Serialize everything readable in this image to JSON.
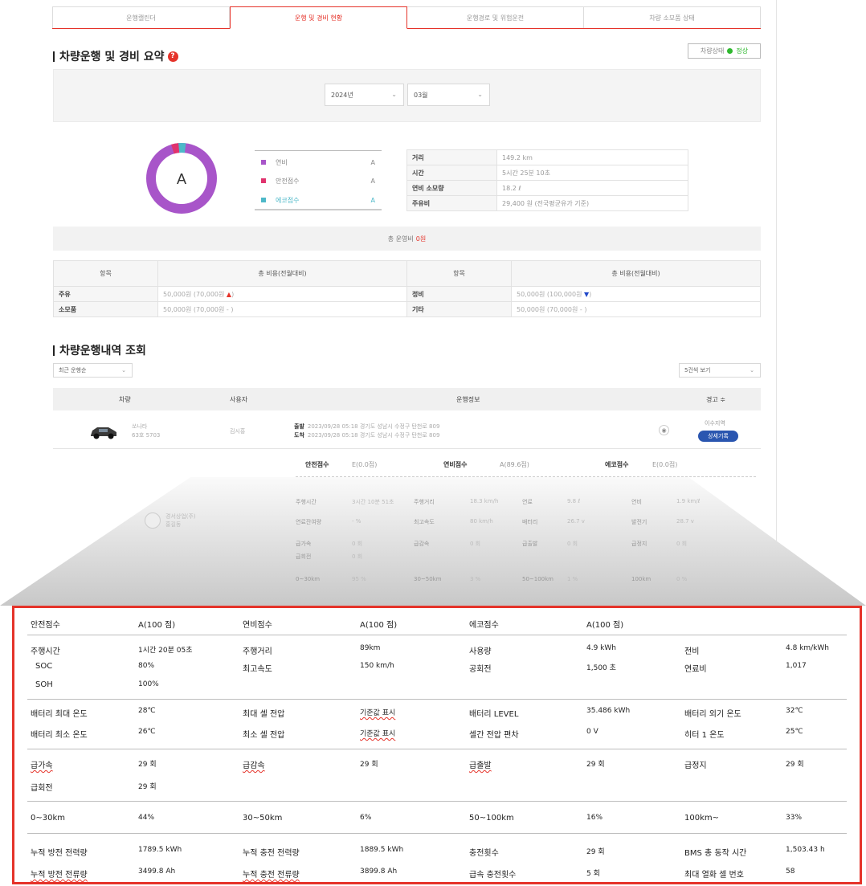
{
  "tabs": [
    "운행캘린더",
    "운행 및 경비 현황",
    "운행경로 및 위험운전",
    "차량 소모품 상태"
  ],
  "summary": {
    "title": "차량운행 및 경비 요약",
    "help": "?",
    "status_label": "차량상태",
    "status_value": "정상",
    "year": "2024년",
    "month": "03월",
    "grade": "A",
    "legend": [
      {
        "label": "연비",
        "grade": "A",
        "color": "#a855c9"
      },
      {
        "label": "안전점수",
        "grade": "A",
        "color": "#e0336e"
      },
      {
        "label": "에코점수",
        "grade": "A",
        "color": "#4db8c8"
      }
    ],
    "info": [
      {
        "key": "거리",
        "value": "149.2 km"
      },
      {
        "key": "시간",
        "value": "5시간 25분 10초"
      },
      {
        "key": "연비 소모량",
        "value": "18.2 ℓ"
      },
      {
        "key": "주유비",
        "value": "29,400 원 (전국평균유가 기준)"
      }
    ],
    "total_label": "총 운영비",
    "total_value": "0원"
  },
  "cost": {
    "headers": [
      "항목",
      "총 비용(전월대비)",
      "항목",
      "총 비용(전월대비)"
    ],
    "rows": [
      {
        "k1": "주유",
        "v1": "50,000원  (70,000원 ",
        "m1": "▲",
        "e1": ")",
        "k2": "정비",
        "v2": "50,000원  (100,000원 ",
        "m2": "▼",
        "e2": ")"
      },
      {
        "k1": "소모품",
        "v1": "50,000원  (70,000원 - )",
        "m1": "",
        "e1": "",
        "k2": "기타",
        "v2": "50,000원  (70,000원 - )",
        "m2": "",
        "e2": ""
      }
    ]
  },
  "history": {
    "title": "차량운행내역 조회",
    "sort": "최근 운행순",
    "page_size": "5건씩 보기",
    "headers": {
      "car": "차량",
      "user": "사용자",
      "info": "운행정보",
      "warn": "경고 ≑"
    },
    "row": {
      "car_name": "쏘나타",
      "plate": "63호 5703",
      "user": "김시흥",
      "depart_label": "출발",
      "depart": "2023/09/28 05:18 경기도 성남시 수정구 탄천로 809",
      "arrive_label": "도착",
      "arrive": "2023/09/28 05:18 경기도 성남시 수정구 탄천로 809",
      "warn": "이수지역",
      "detail_btn": "상세기록"
    },
    "scores": {
      "safe_label": "안전점수",
      "safe": "E(0.0점)",
      "fuel_label": "연비점수",
      "fuel": "A(89.6점)",
      "eco_label": "에코점수",
      "eco": "E(0.0점)"
    }
  },
  "faded": {
    "company": "경서상업(주)",
    "user": "홍길동",
    "rows": [
      [
        "주행시간",
        "3시간 10분 51초",
        "주행거리",
        "18.3 km/h",
        "연료",
        "9.8 ℓ",
        "연비",
        "1.9 km/ℓ"
      ],
      [
        "연료잔여량",
        "- %",
        "최고속도",
        "80 km/h",
        "배터리",
        "26.7 v",
        "발전기",
        "28.7 v"
      ],
      [
        "급가속",
        "0 회",
        "급감속",
        "0 회",
        "급출발",
        "0 회",
        "급정지",
        "0 회"
      ],
      [
        "급회전",
        "0 회",
        "",
        "",
        "",
        "",
        "",
        ""
      ],
      [
        "0~30km",
        "95 %",
        "30~50km",
        "3 %",
        "50~100km",
        "1 %",
        "100km",
        "0 %"
      ]
    ]
  },
  "detail": {
    "scores": [
      "안전점수",
      "A(100 점)",
      "연비점수",
      "A(100 점)",
      "에코점수",
      "A(100 점)"
    ],
    "r1": [
      "주행시간",
      "1시간 20분 05초",
      "주행거리",
      "89km",
      "사용량",
      "4.9 kWh",
      "전비",
      "4.8 km/kWh"
    ],
    "r2": [
      "SOC",
      "80%",
      "최고속도",
      "150 km/h",
      "공회전",
      "1,500 초",
      "연료비",
      "1,017"
    ],
    "r3": [
      "SOH",
      "100%"
    ],
    "r4": [
      "배터리 최대 온도",
      "28℃",
      "최대 셀 전압",
      "기준값 표시",
      "배터리 LEVEL",
      "35.486 kWh",
      "배터리 외기 온도",
      "32℃"
    ],
    "r5": [
      "배터리 최소 온도",
      "26℃",
      "최소 셀 전압",
      "기준값 표시",
      "셀간 전압 편차",
      "0 V",
      "히터 1 온도",
      "25℃"
    ],
    "r6": [
      "급가속",
      "29 회",
      "급감속",
      "29 회",
      "급출발",
      "29 회",
      "급정지",
      "29 회"
    ],
    "r7": [
      "급회전",
      "29 회"
    ],
    "r8": [
      "0~30km",
      "44%",
      "30~50km",
      "6%",
      "50~100km",
      "16%",
      "100km~",
      "33%"
    ],
    "r9": [
      "누적 방전 전력량",
      "1789.5 kWh",
      "누적 충전 전력량",
      "1889.5 kWh",
      "충전횟수",
      "29 회",
      "BMS 총 동작 시간",
      "1,503.43 h"
    ],
    "r10": [
      "누적 방전 전류량",
      "3499.8 Ah",
      "누적 충전 전류량",
      "3899.8 Ah",
      "급속 충전횟수",
      "5 회",
      "최대 열화 셀 번호",
      "58"
    ]
  }
}
